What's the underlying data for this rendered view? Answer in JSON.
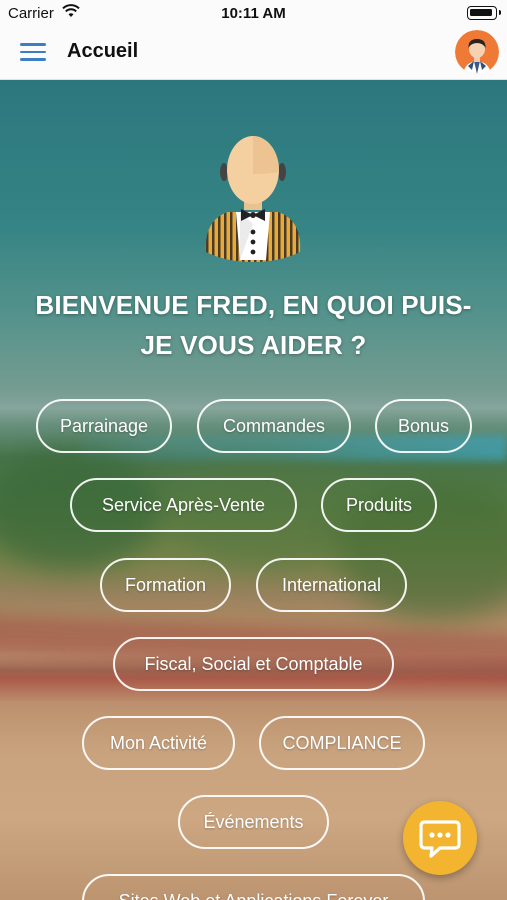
{
  "status_bar": {
    "carrier": "Carrier",
    "time": "10:11 AM",
    "icons": [
      "wifi-icon",
      "battery-icon"
    ]
  },
  "nav": {
    "title": "Accueil",
    "menu_icon": "hamburger-menu-icon",
    "avatar_icon": "user-avatar",
    "accent_color": "#3c7dc4"
  },
  "hero": {
    "illustration": "butler-icon",
    "welcome_line1": "BIENVENUE FRED, EN QUOI PUIS-",
    "welcome_line2": "JE VOUS AIDER ?"
  },
  "topics": [
    "Parrainage",
    "Commandes",
    "Bonus",
    "Service Après-Vente",
    "Produits",
    "Formation",
    "International",
    "Fiscal, Social et Comptable",
    "Mon Activité",
    "COMPLIANCE",
    "Événements",
    "Sites Web et Applications Forever"
  ],
  "chat_button": {
    "icon": "chat-bubble-icon",
    "color": "#f3b42f"
  }
}
